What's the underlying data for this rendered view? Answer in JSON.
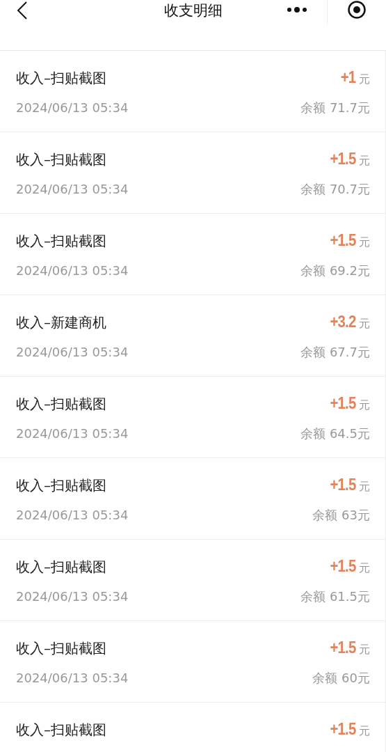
{
  "header": {
    "title": "收支明细"
  },
  "records": [
    {
      "title": "收入–扫贴截图",
      "amount": "+1",
      "unit": "元",
      "date": "2024/06/13 05:34",
      "balance": "余额 71.7元"
    },
    {
      "title": "收入–扫贴截图",
      "amount": "+1.5",
      "unit": "元",
      "date": "2024/06/13 05:34",
      "balance": "余额 70.7元"
    },
    {
      "title": "收入–扫贴截图",
      "amount": "+1.5",
      "unit": "元",
      "date": "2024/06/13 05:34",
      "balance": "余额 69.2元"
    },
    {
      "title": "收入–新建商机",
      "amount": "+3.2",
      "unit": "元",
      "date": "2024/06/13 05:34",
      "balance": "余额 67.7元"
    },
    {
      "title": "收入–扫贴截图",
      "amount": "+1.5",
      "unit": "元",
      "date": "2024/06/13 05:34",
      "balance": "余额 64.5元"
    },
    {
      "title": "收入–扫贴截图",
      "amount": "+1.5",
      "unit": "元",
      "date": "2024/06/13 05:34",
      "balance": "余额 63元"
    },
    {
      "title": "收入–扫贴截图",
      "amount": "+1.5",
      "unit": "元",
      "date": "2024/06/13 05:34",
      "balance": "余额 61.5元"
    },
    {
      "title": "收入–扫贴截图",
      "amount": "+1.5",
      "unit": "元",
      "date": "2024/06/13 05:34",
      "balance": "余额 60元"
    },
    {
      "title": "收入–扫贴截图",
      "amount": "+1.5",
      "unit": "元"
    }
  ]
}
